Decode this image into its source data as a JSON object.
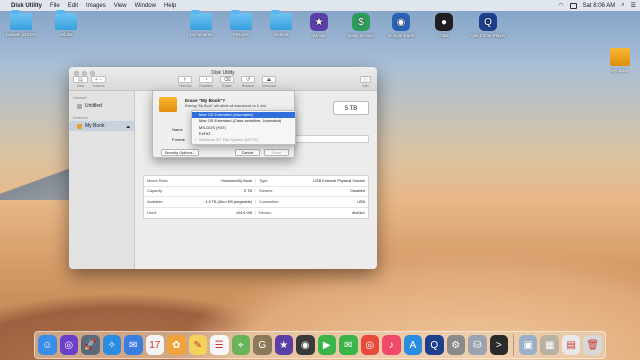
{
  "menubar": {
    "app_name": "Disk Utility",
    "items": [
      "File",
      "Edit",
      "Images",
      "View",
      "Window",
      "Help"
    ],
    "clock": "Sat 8:06 AM"
  },
  "desktop_icons": [
    {
      "label": "huawei p20 lite",
      "kind": "folder"
    },
    {
      "label": "velo65",
      "kind": "folder"
    },
    {
      "label": "Documents",
      "kind": "folder"
    },
    {
      "label": "Pictures",
      "kind": "folder"
    },
    {
      "label": "Videos",
      "kind": "folder"
    },
    {
      "label": "iMovie",
      "kind": "app",
      "color": "#5b3fa6",
      "glyph": "★"
    },
    {
      "label": "Easy Invoice",
      "kind": "app",
      "color": "#2e9d5a",
      "glyph": "$"
    },
    {
      "label": "Google Earth",
      "kind": "app",
      "color": "#2a62b8",
      "glyph": "◉"
    },
    {
      "label": "OBS",
      "kind": "app",
      "color": "#1f1f1f",
      "glyph": "●"
    },
    {
      "label": "QuickTime Player",
      "kind": "app",
      "color": "#1d3f8c",
      "glyph": "Q"
    }
  ],
  "right_icon": {
    "label": "My Book"
  },
  "window": {
    "title": "Disk Utility",
    "toolbar_left": [
      {
        "label": "View",
        "glyph": "▤"
      },
      {
        "label": "Volume",
        "glyph": "+ −"
      }
    ],
    "toolbar": [
      {
        "label": "First Aid",
        "glyph": "⚕"
      },
      {
        "label": "Partition",
        "glyph": "◔"
      },
      {
        "label": "Erase",
        "glyph": "⌫"
      },
      {
        "label": "Restore",
        "glyph": "↺"
      },
      {
        "label": "Unmount",
        "glyph": "⏏"
      }
    ],
    "toolbar_right": {
      "label": "Info",
      "glyph": "ⓘ"
    },
    "sidebar": {
      "sections": [
        {
          "title": "Internal",
          "items": [
            "Untitled"
          ]
        },
        {
          "title": "External",
          "items": [
            "My Book"
          ]
        }
      ]
    },
    "size": "5 TB",
    "info_rows": [
      {
        "k1": "Mount Point:",
        "v1": "/Volumes/My Book",
        "k2": "Type:",
        "v2": "USB External Physical Volume"
      },
      {
        "k1": "Capacity:",
        "v1": "5 TB",
        "k2": "Owners:",
        "v2": "Disabled"
      },
      {
        "k1": "Available:",
        "v1": "4.9 TB (Zero KB purgeable)",
        "k2": "Connection:",
        "v2": "USB"
      },
      {
        "k1": "Used:",
        "v1": "104.6 GB",
        "k2": "Device:",
        "v2": "disk3s1"
      }
    ]
  },
  "erase_sheet": {
    "title": "Erase \"My Book\"?",
    "description": "Erasing \"My Book\" will delete all data stored on it, and",
    "name_label": "Name",
    "format_label": "Format",
    "security_button": "Security Options...",
    "cancel_button": "Cancel",
    "erase_button": "Erase",
    "format_options": [
      {
        "label": "Mac OS Extended (Journaled)",
        "state": "highlighted"
      },
      {
        "label": "Mac OS Extended (Case-sensitive, Journaled)",
        "state": "normal"
      },
      {
        "label": "MS-DOS (FAT)",
        "state": "normal"
      },
      {
        "label": "ExFAT",
        "state": "normal"
      },
      {
        "label": "Windows NT File System (NTFS)",
        "state": "disabled",
        "checked": true
      }
    ]
  },
  "dock": [
    {
      "name": "Finder",
      "color": "#3a8ee6",
      "glyph": "☺"
    },
    {
      "name": "Siri",
      "color": "#6a3fc9",
      "glyph": "◎"
    },
    {
      "name": "Launchpad",
      "color": "#5c6a7d",
      "glyph": "🚀"
    },
    {
      "name": "Safari",
      "color": "#2a8de0",
      "glyph": "✧"
    },
    {
      "name": "Mail",
      "color": "#3a7ee0",
      "glyph": "✉"
    },
    {
      "name": "Calendar",
      "color": "#f4f4f4",
      "glyph": "17"
    },
    {
      "name": "Photos",
      "color": "#f0a33a",
      "glyph": "✿"
    },
    {
      "name": "Notes",
      "color": "#f2d35a",
      "glyph": "✎"
    },
    {
      "name": "Reminders",
      "color": "#f7f7f7",
      "glyph": "☰"
    },
    {
      "name": "Maps",
      "color": "#69b35a",
      "glyph": "⌖"
    },
    {
      "name": "GIMP",
      "color": "#8a7a5a",
      "glyph": "G"
    },
    {
      "name": "iMovie",
      "color": "#5b3fa6",
      "glyph": "★"
    },
    {
      "name": "Camera",
      "color": "#3a3a3a",
      "glyph": "◉"
    },
    {
      "name": "FaceTime",
      "color": "#3bb54a",
      "glyph": "▶"
    },
    {
      "name": "Messages",
      "color": "#3bb54a",
      "glyph": "✉"
    },
    {
      "name": "Chrome",
      "color": "#e64a3a",
      "glyph": "◎"
    },
    {
      "name": "Music",
      "color": "#f04a6a",
      "glyph": "♪"
    },
    {
      "name": "App Store",
      "color": "#2a8de0",
      "glyph": "A"
    },
    {
      "name": "QuickTime",
      "color": "#1d3f8c",
      "glyph": "Q"
    },
    {
      "name": "System Preferences",
      "color": "#8a8a8a",
      "glyph": "⚙"
    },
    {
      "name": "Disk Utility",
      "color": "#9aa4b0",
      "glyph": "⛁"
    },
    {
      "name": "Terminal",
      "color": "#2a2a2a",
      "glyph": ">"
    },
    {
      "name": "Preview",
      "color": "#9ab0c8",
      "glyph": "▣"
    },
    {
      "name": "Archive Utility",
      "color": "#b8b0a0",
      "glyph": "▦"
    },
    {
      "name": "Documents",
      "color": "#e8e8e8",
      "glyph": "▤"
    },
    {
      "name": "Trash",
      "color": "#d8d8d8",
      "glyph": "🗑"
    }
  ]
}
